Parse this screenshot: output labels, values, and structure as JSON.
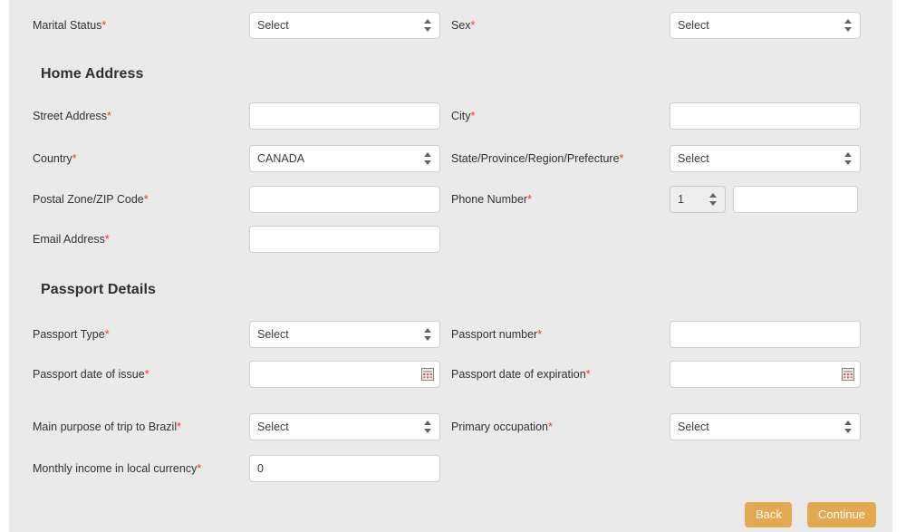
{
  "form": {
    "required_marker": "*",
    "select_placeholder": "Select",
    "accent_color": "#e4a950",
    "required_color": "#ef3b24",
    "panel_color": "#eaeaea"
  },
  "rows": {
    "marital_status": {
      "label": "Marital Status",
      "value": "Select",
      "type": "select"
    },
    "sex": {
      "label": "Sex",
      "value": "Select",
      "type": "select"
    },
    "street_address": {
      "label": "Street Address",
      "value": "",
      "type": "text"
    },
    "city": {
      "label": "City",
      "value": "",
      "type": "text"
    },
    "country": {
      "label": "Country",
      "value": "CANADA",
      "type": "select"
    },
    "state_province": {
      "label": "State/Province/Region/Prefecture",
      "value": "Select",
      "type": "select"
    },
    "postal_code": {
      "label": "Postal Zone/ZIP Code",
      "value": "",
      "type": "text"
    },
    "phone_number": {
      "label": "Phone Number",
      "country_code": "1",
      "value": "",
      "type": "phone"
    },
    "email_address": {
      "label": "Email Address",
      "value": "",
      "type": "text"
    },
    "passport_type": {
      "label": "Passport Type",
      "value": "Select",
      "type": "select"
    },
    "passport_number": {
      "label": "Passport number",
      "value": "",
      "type": "text"
    },
    "passport_issue": {
      "label": "Passport date of issue",
      "value": "",
      "type": "date"
    },
    "passport_expiration": {
      "label": "Passport date of expiration",
      "value": "",
      "type": "date"
    },
    "trip_purpose": {
      "label": "Main purpose of trip to Brazil",
      "value": "Select",
      "type": "select"
    },
    "primary_occupation": {
      "label": "Primary occupation",
      "value": "Select",
      "type": "select"
    },
    "monthly_income": {
      "label": "Monthly income in local currency",
      "value": "0",
      "type": "text"
    }
  },
  "headings": {
    "home_address": "Home Address",
    "passport_details": "Passport Details"
  },
  "buttons": {
    "back": "Back",
    "continue": "Continue"
  },
  "icons": {
    "calendar": "calendar-icon",
    "select_arrows": "sort-arrows-icon"
  }
}
